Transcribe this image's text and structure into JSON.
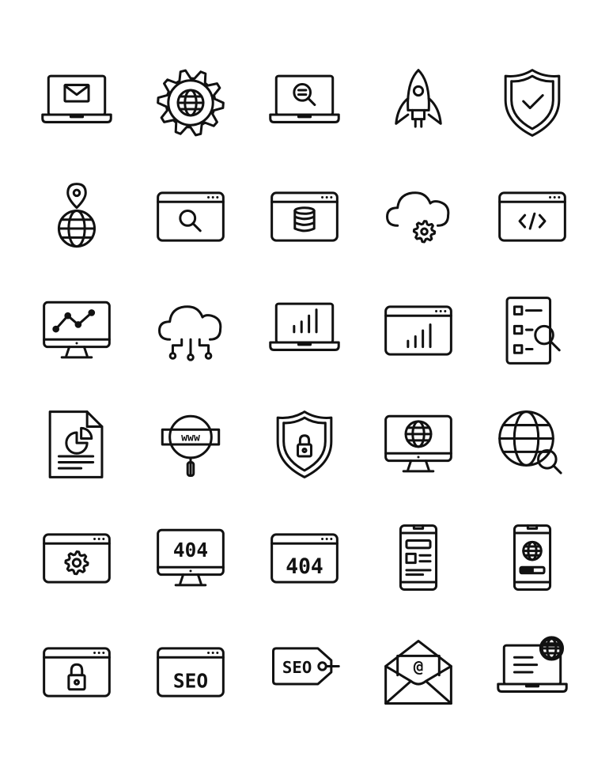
{
  "colors": {
    "background": "#ffffff",
    "stroke": "#111111"
  },
  "icons": [
    {
      "name": "laptop-mail-icon"
    },
    {
      "name": "gear-globe-icon"
    },
    {
      "name": "laptop-search-icon"
    },
    {
      "name": "rocket-icon"
    },
    {
      "name": "shield-check-icon"
    },
    {
      "name": "globe-location-icon"
    },
    {
      "name": "browser-search-icon"
    },
    {
      "name": "browser-database-icon"
    },
    {
      "name": "cloud-gear-icon"
    },
    {
      "name": "browser-code-icon"
    },
    {
      "name": "monitor-analytics-icon"
    },
    {
      "name": "cloud-network-icon"
    },
    {
      "name": "laptop-bar-chart-icon"
    },
    {
      "name": "browser-bar-chart-icon"
    },
    {
      "name": "checklist-search-icon"
    },
    {
      "name": "document-pie-chart-icon"
    },
    {
      "name": "www-search-icon",
      "text": "www"
    },
    {
      "name": "shield-lock-icon"
    },
    {
      "name": "monitor-globe-icon"
    },
    {
      "name": "globe-search-icon"
    },
    {
      "name": "browser-settings-icon"
    },
    {
      "name": "monitor-404-icon",
      "text": "404"
    },
    {
      "name": "browser-404-icon",
      "text": "404"
    },
    {
      "name": "mobile-article-icon"
    },
    {
      "name": "mobile-globe-icon"
    },
    {
      "name": "browser-lock-icon"
    },
    {
      "name": "browser-seo-icon",
      "text": "SEO"
    },
    {
      "name": "seo-tag-icon",
      "text": "SEO"
    },
    {
      "name": "email-at-icon",
      "text": "@"
    },
    {
      "name": "laptop-globe-icon"
    }
  ]
}
